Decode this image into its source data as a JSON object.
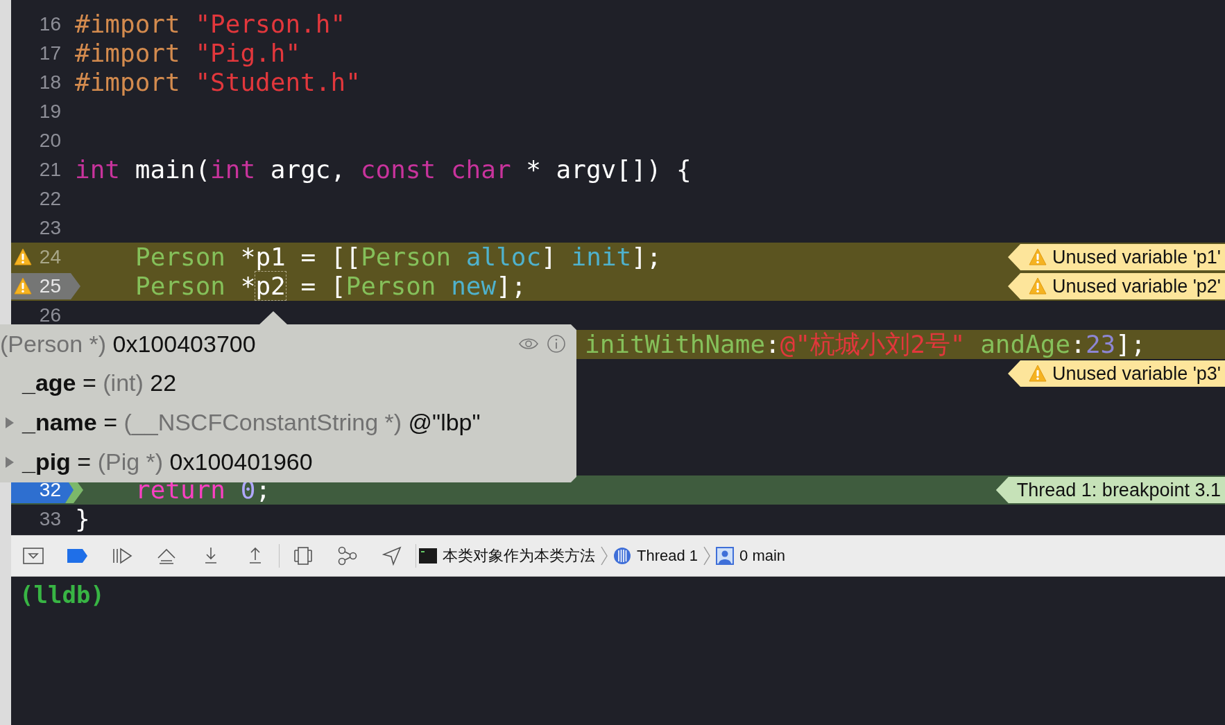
{
  "editor": {
    "lines": [
      {
        "number": "16",
        "segments": [
          {
            "kind": "directive",
            "text": "#import"
          },
          {
            "kind": "string",
            "text": " \"Person.h\""
          }
        ]
      },
      {
        "number": "17",
        "segments": [
          {
            "kind": "directive",
            "text": "#import"
          },
          {
            "kind": "string",
            "text": " \"Pig.h\""
          }
        ]
      },
      {
        "number": "18",
        "segments": [
          {
            "kind": "directive",
            "text": "#import"
          },
          {
            "kind": "string",
            "text": " \"Student.h\""
          }
        ]
      },
      {
        "number": "19"
      },
      {
        "number": "20"
      },
      {
        "number": "21",
        "segments": [
          {
            "kind": "keyword",
            "text": "int"
          },
          {
            "kind": "plain",
            "text": " main("
          },
          {
            "kind": "keyword",
            "text": "int"
          },
          {
            "kind": "plain",
            "text": " argc, "
          },
          {
            "kind": "keyword",
            "text": "const"
          },
          {
            "kind": "keyword",
            "text": " char"
          },
          {
            "kind": "plain",
            "text": " * argv[]) {"
          }
        ]
      },
      {
        "number": "22"
      },
      {
        "number": "23"
      },
      {
        "number": "24",
        "kind": "warning",
        "warning": true,
        "indented": true,
        "segments": [
          {
            "kind": "type",
            "text": "Person"
          },
          {
            "kind": "plain",
            "text": " *p1 = [["
          },
          {
            "kind": "type",
            "text": "Person"
          },
          {
            "kind": "method",
            "text": " alloc"
          },
          {
            "kind": "plain",
            "text": "] "
          },
          {
            "kind": "method",
            "text": "init"
          },
          {
            "kind": "plain",
            "text": "];"
          }
        ],
        "annotation": {
          "kind": "warning",
          "text": "Unused variable 'p1'"
        }
      },
      {
        "number": "25",
        "kind": "warning",
        "warning": true,
        "breakpoint": {
          "enabled": false
        },
        "indented": true,
        "segments": [
          {
            "kind": "type",
            "text": "Person"
          },
          {
            "kind": "plain",
            "text": " *"
          },
          {
            "kind": "hovered",
            "text": "p2"
          },
          {
            "kind": "plain",
            "text": " = ["
          },
          {
            "kind": "type",
            "text": "Person"
          },
          {
            "kind": "method",
            "text": " new"
          },
          {
            "kind": "plain",
            "text": "];"
          }
        ],
        "annotation": {
          "kind": "warning",
          "text": "Unused variable 'p2'"
        }
      },
      {
        "number": "26"
      },
      {
        "kind": "warning",
        "covered_start": true,
        "segments": [
          {
            "kind": "type",
            "text": "initWithName"
          },
          {
            "kind": "plain",
            "text": ":"
          },
          {
            "kind": "string",
            "text": "@\"杭城小刘2号\""
          },
          {
            "kind": "type",
            "text": " andAge"
          },
          {
            "kind": "plain",
            "text": ":"
          },
          {
            "kind": "number",
            "text": "23"
          },
          {
            "kind": "plain",
            "text": "];"
          }
        ]
      },
      {
        "annotation": {
          "kind": "warning",
          "text": "Unused variable 'p3'"
        }
      }
    ],
    "lines_after_popover": [
      {
        "number": "32",
        "kind": "current",
        "breakpoint": {
          "enabled": true
        },
        "indented": true,
        "segments": [
          {
            "kind": "keyword",
            "text": "return"
          },
          {
            "kind": "number",
            "text": " 0"
          },
          {
            "kind": "plain",
            "text": ";"
          }
        ],
        "annotation": {
          "kind": "thread",
          "text": "Thread 1: breakpoint 3.1"
        }
      },
      {
        "number": "33",
        "segments": [
          {
            "kind": "plain",
            "text": "}"
          }
        ]
      }
    ]
  },
  "popover": {
    "type": "(Person *)",
    "value": "0x100403700",
    "fields": [
      {
        "name": "_age",
        "operator": "=",
        "type": "(int)",
        "value": "22",
        "expandable": false
      },
      {
        "name": "_name",
        "operator": "=",
        "type": "(__NSCFConstantString *)",
        "value": "@\"lbp\"",
        "expandable": true
      },
      {
        "name": "_pig",
        "operator": "=",
        "type": "(Pig *)",
        "value": "0x100401960",
        "expandable": true
      }
    ]
  },
  "debug_bar": {
    "breakpoints_active": true,
    "breadcrumbs": [
      {
        "kind": "process",
        "label": "本类对象作为本类方法"
      },
      {
        "kind": "thread",
        "label": "Thread 1"
      },
      {
        "kind": "frame",
        "label": "0 main"
      }
    ]
  },
  "console": {
    "prompt": "(lldb)"
  }
}
